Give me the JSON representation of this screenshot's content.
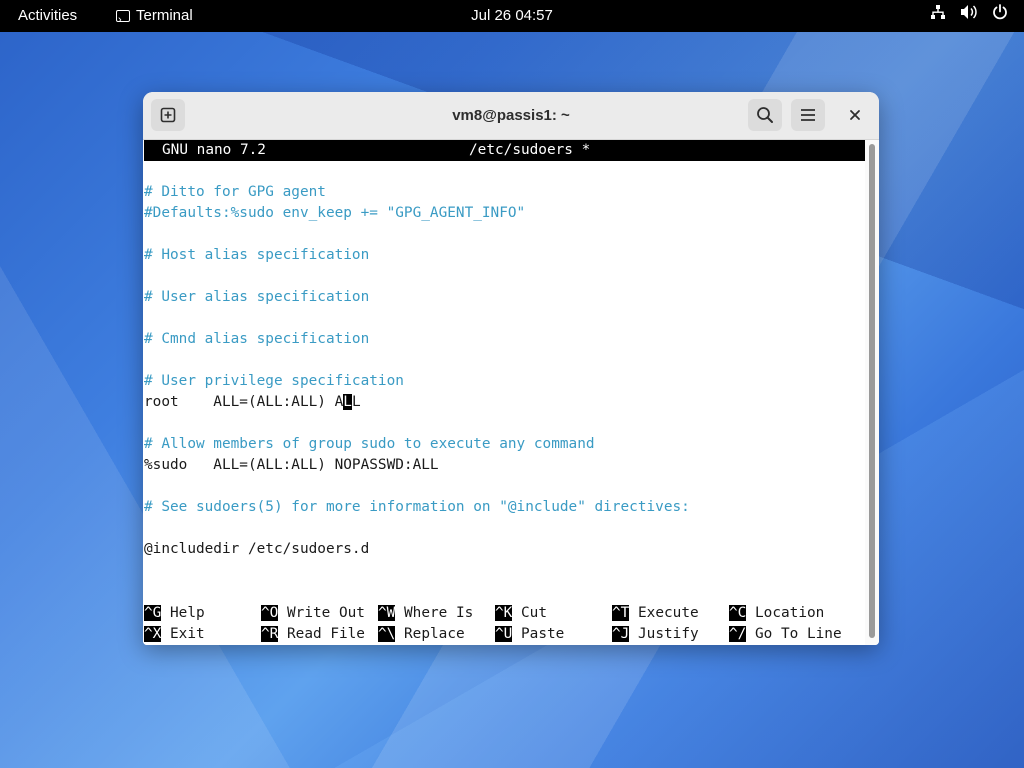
{
  "topbar": {
    "activities": "Activities",
    "app_name": "Terminal",
    "clock": "Jul 26  04:57",
    "tray_icons": [
      "network-icon",
      "volume-icon",
      "power-icon"
    ]
  },
  "window": {
    "title": "vm8@passis1: ~"
  },
  "nano": {
    "version": "GNU nano 7.2",
    "filename": "/etc/sudoers *",
    "lines": [
      {
        "text": "# Ditto for GPG agent",
        "type": "comment"
      },
      {
        "text": "#Defaults:%sudo env_keep += \"GPG_AGENT_INFO\"",
        "type": "comment"
      },
      {
        "text": "",
        "type": "blank"
      },
      {
        "text": "# Host alias specification",
        "type": "comment"
      },
      {
        "text": "",
        "type": "blank"
      },
      {
        "text": "# User alias specification",
        "type": "comment"
      },
      {
        "text": "",
        "type": "blank"
      },
      {
        "text": "# Cmnd alias specification",
        "type": "comment"
      },
      {
        "text": "",
        "type": "blank"
      },
      {
        "text": "# User privilege specification",
        "type": "comment"
      },
      {
        "text": "root    ALL=(ALL:ALL) A",
        "cursor": "L",
        "after": "L",
        "type": "code"
      },
      {
        "text": "",
        "type": "blank"
      },
      {
        "text": "# Allow members of group sudo to execute any command",
        "type": "comment"
      },
      {
        "text": "%sudo   ALL=(ALL:ALL) NOPASSWD:ALL",
        "type": "code"
      },
      {
        "text": "",
        "type": "blank"
      },
      {
        "text": "# See sudoers(5) for more information on \"@include\" directives:",
        "type": "comment"
      },
      {
        "text": "",
        "type": "blank"
      },
      {
        "text": "@includedir /etc/sudoers.d",
        "type": "code"
      }
    ],
    "shortcuts_row1": [
      {
        "key": "^G",
        "label": "Help"
      },
      {
        "key": "^O",
        "label": "Write Out"
      },
      {
        "key": "^W",
        "label": "Where Is"
      },
      {
        "key": "^K",
        "label": "Cut"
      },
      {
        "key": "^T",
        "label": "Execute"
      },
      {
        "key": "^C",
        "label": "Location"
      }
    ],
    "shortcuts_row2": [
      {
        "key": "^X",
        "label": "Exit"
      },
      {
        "key": "^R",
        "label": "Read File"
      },
      {
        "key": "^\\",
        "label": "Replace"
      },
      {
        "key": "^U",
        "label": "Paste"
      },
      {
        "key": "^J",
        "label": "Justify"
      },
      {
        "key": "^/",
        "label": "Go To Line"
      }
    ]
  },
  "colors": {
    "comment": "#3a9bc4",
    "titlebar": "#ebebeb",
    "panel": "#000000"
  }
}
